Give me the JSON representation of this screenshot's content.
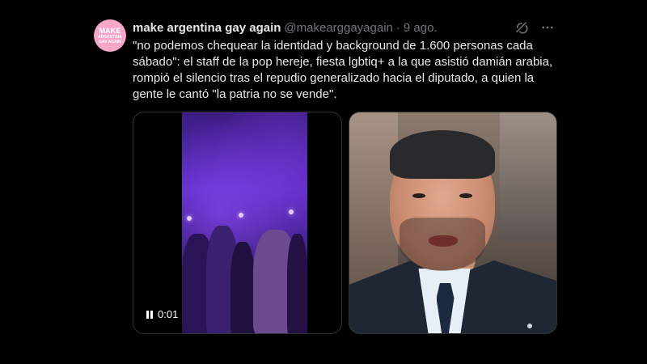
{
  "avatar": {
    "line1": "MAKE",
    "line2": "ARGENTINA",
    "line3": "GAY AGAIN",
    "bg_color": "#f5a6c9"
  },
  "tweet": {
    "display_name": "make argentina gay again",
    "handle": "@makearggayagain",
    "separator": "·",
    "date": "9 ago.",
    "text": "\"no podemos chequear la identidad y background de 1.600 personas cada sábado\": el staff de la pop hereje, fiesta lgbtiq+ a la que asistió damián arabia, rompió el silencio tras el repudio generalizado hacia el diputado, a quien la gente le cantó \"la patria no se vende\"."
  },
  "actions": {
    "icons": [
      "grok-icon",
      "more-icon"
    ]
  },
  "media": {
    "video": {
      "timestamp": "0:01",
      "state_icon": "pause-icon"
    }
  },
  "colors": {
    "background": "#000000",
    "text_primary": "#e7e9ea",
    "text_secondary": "#71767b",
    "border": "#2f3336"
  }
}
